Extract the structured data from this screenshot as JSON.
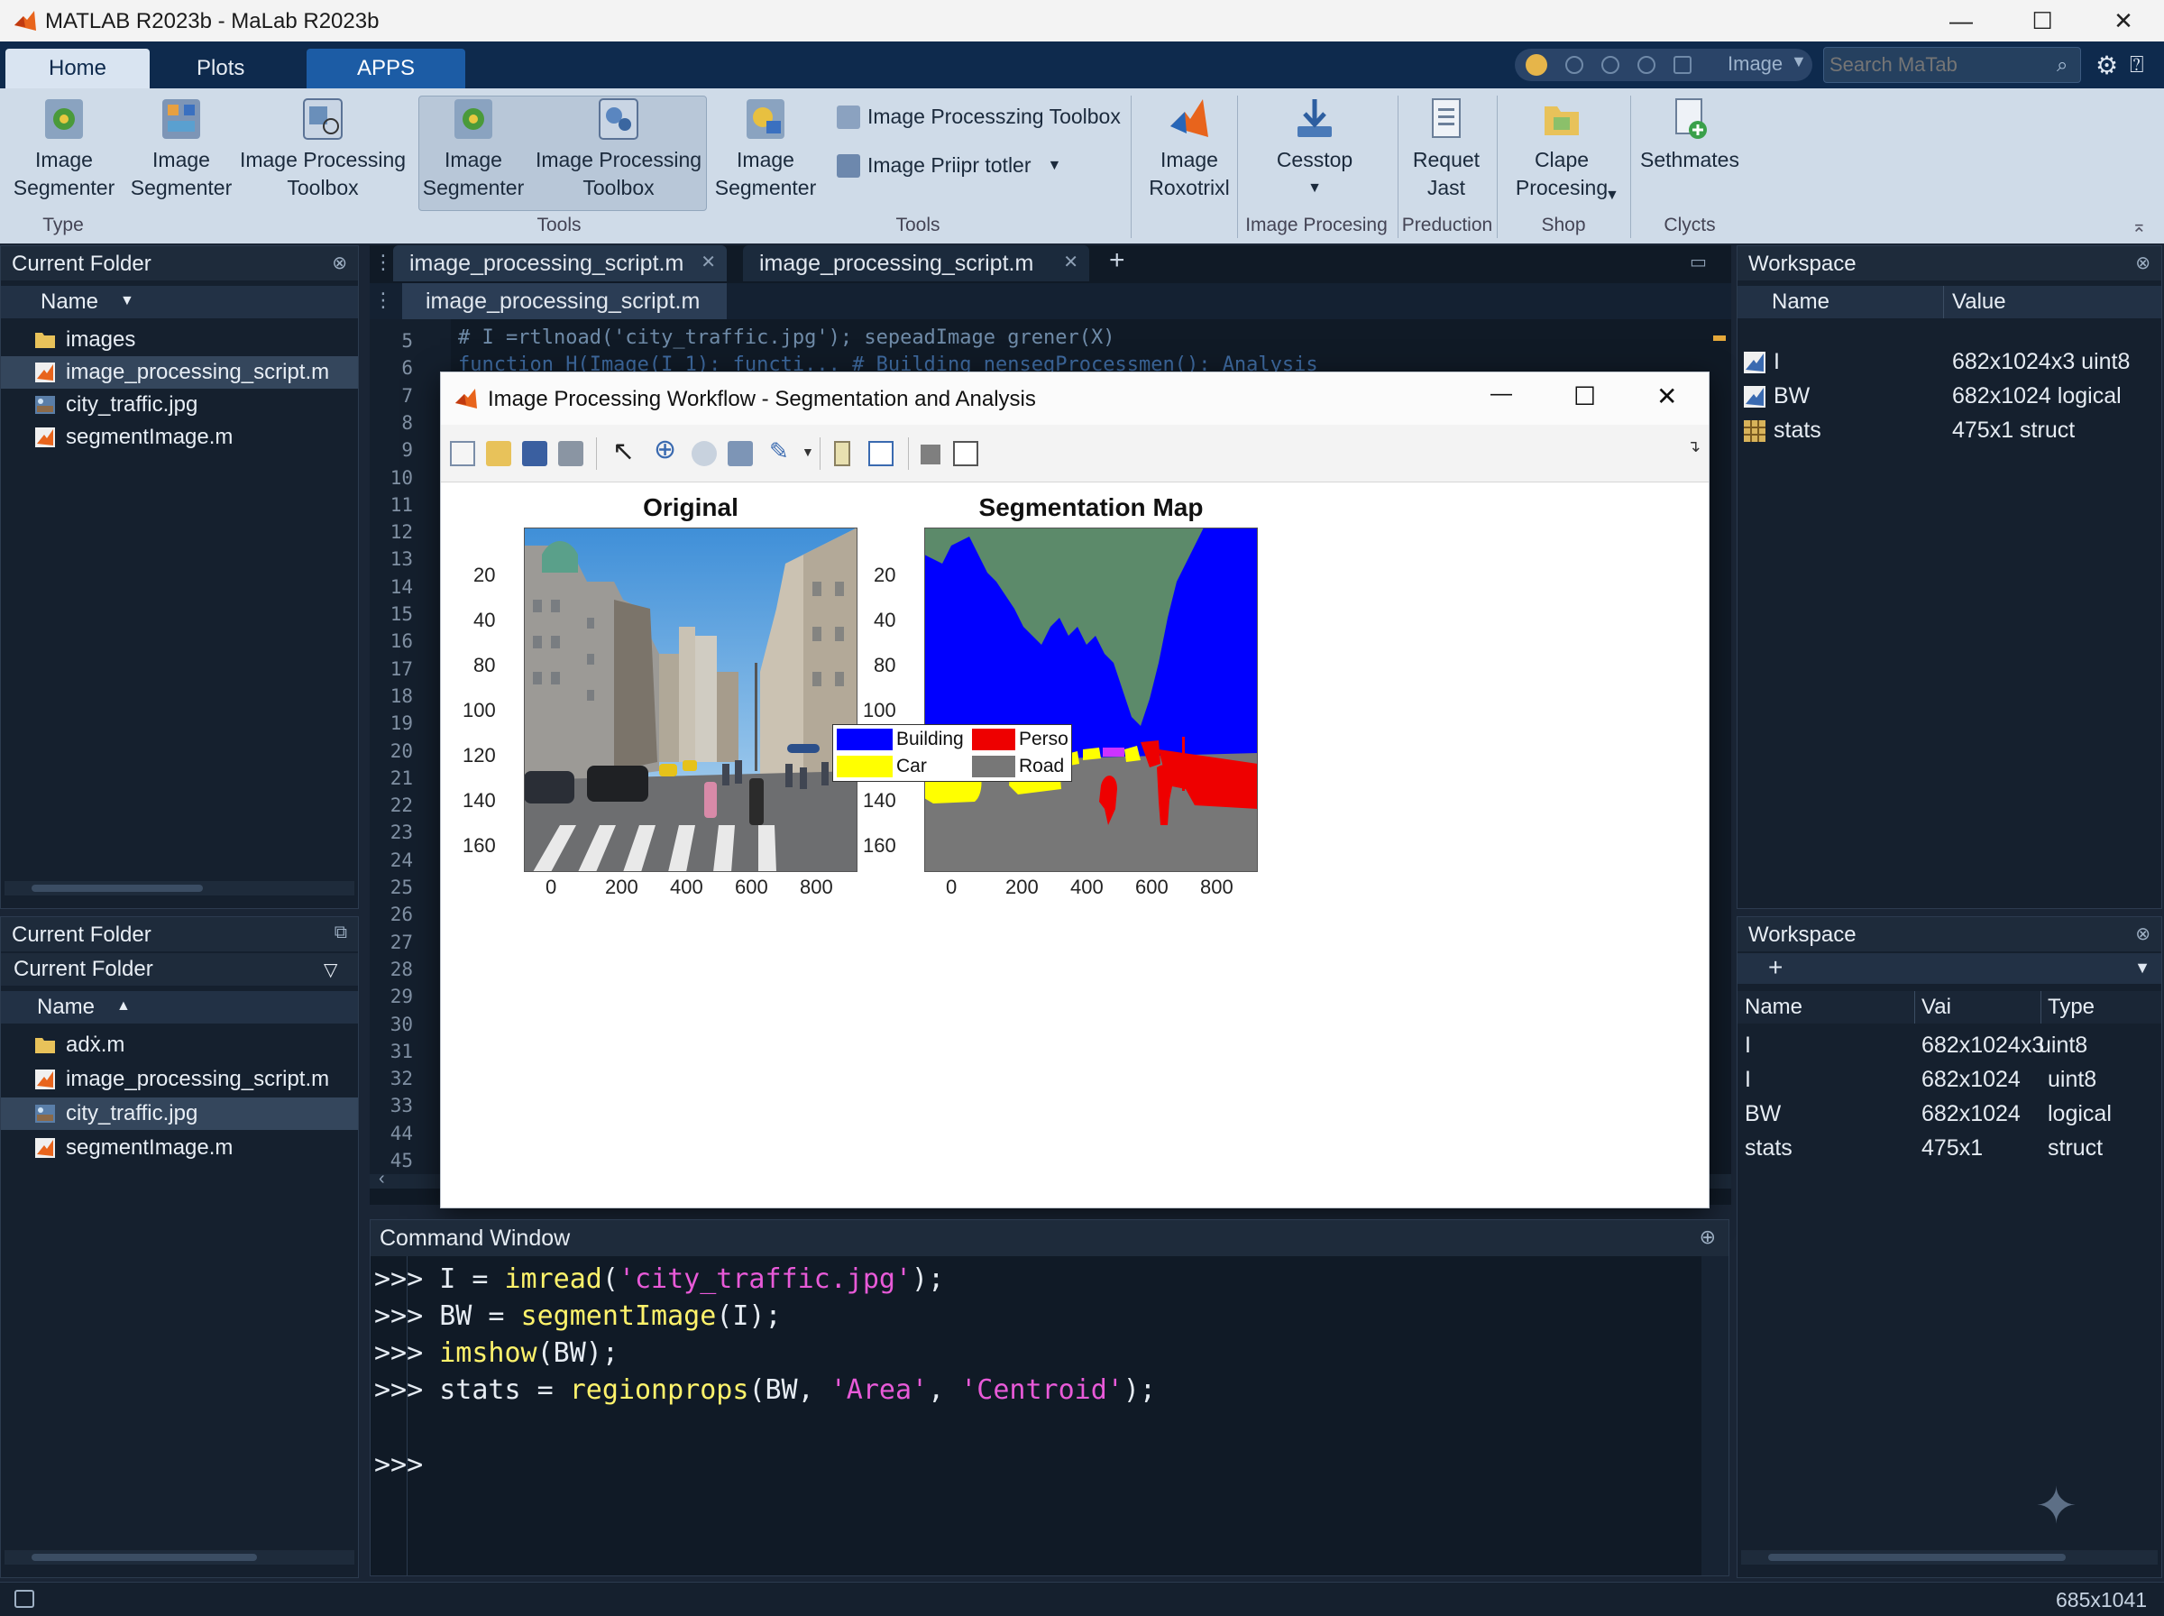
{
  "window": {
    "title": "MATLAB R2023b - MaLab R2023b"
  },
  "ribbon_tabs": [
    "Home",
    "Plots",
    "APPS"
  ],
  "search": {
    "placeholder": "Search MaTab",
    "quick_access_label": "Image"
  },
  "ribbon": {
    "buttons": [
      {
        "label": "Image\nSegmenter",
        "icon": "image-segmenter-icon"
      },
      {
        "label": "Image\nSegmenter",
        "icon": "image-segmenter-icon"
      },
      {
        "label": "Image Processing\nToolbox",
        "icon": "toolbox-icon"
      },
      {
        "label": "Image\nSegmenter",
        "icon": "image-segmenter-icon"
      },
      {
        "label": "Image Processing\nToolbox",
        "icon": "toolbox-icon"
      },
      {
        "label": "Image\nSegmenter",
        "icon": "image-segmenter-icon"
      },
      {
        "label": "Image\nRoxotrixl",
        "icon": "matlab-logo-icon"
      },
      {
        "label": "Cesstop",
        "icon": "download-icon"
      },
      {
        "label": "Requet\nJast",
        "icon": "document-icon"
      },
      {
        "label": "Clape\nProcesing",
        "icon": "folder-icon"
      },
      {
        "label": "Sethmates",
        "icon": "add-file-icon"
      }
    ],
    "small_buttons": [
      "Image Processzing Toolbox",
      "Image Priipr totler"
    ],
    "group_labels": [
      "Type",
      "Tools",
      "Tools",
      "Image Procesing",
      "Preduction",
      "Shop",
      "Clycts"
    ]
  },
  "current_folder_top": {
    "title": "Current Folder",
    "column": "Name",
    "files": [
      {
        "name": "images",
        "type": "folder"
      },
      {
        "name": "image_processing_script.m",
        "type": "mfile",
        "selected": true
      },
      {
        "name": "city_traffic.jpg",
        "type": "image"
      },
      {
        "name": "segmentImage.m",
        "type": "mfile"
      }
    ]
  },
  "current_folder_bottom": {
    "title": "Current Folder",
    "subtitle": "Current Folder",
    "column": "Name",
    "files": [
      {
        "name": "adẋ.m",
        "type": "folder"
      },
      {
        "name": "image_processing_script.m",
        "type": "mfile"
      },
      {
        "name": "city_traffic.jpg",
        "type": "image",
        "selected": true
      },
      {
        "name": "segmentImage.m",
        "type": "mfile"
      }
    ]
  },
  "editor": {
    "tabs": [
      "image_processing_script.m",
      "image_processing_script.m"
    ],
    "subtab": "image_processing_script.m",
    "code_line5": "# I =rtlnoad('city_traffic.jpg'); sepeadImage grener(X)",
    "code_line6": "function H(Image(I 1): functi... # Building nensegProcessmen(): Analysis",
    "line_numbers": [
      "5",
      "6",
      "7",
      "8",
      "9",
      "10",
      "11",
      "12",
      "13",
      "14",
      "15",
      "16",
      "17",
      "18",
      "19",
      "20",
      "21",
      "22",
      "23",
      "24",
      "25",
      "26",
      "27",
      "28",
      "29",
      "30",
      "31",
      "32",
      "33",
      "44",
      "45"
    ]
  },
  "figure": {
    "title": "Image Processing Workflow - Segmentation and Analysis",
    "axes_left_title": "Original",
    "axes_right_title": "Segmentation Map",
    "y_ticks": [
      "20",
      "40",
      "80",
      "100",
      "120",
      "140",
      "160"
    ],
    "x_ticks": [
      "0",
      "200",
      "400",
      "600",
      "800"
    ],
    "legend": [
      {
        "label": "Building",
        "color": "#0000ff"
      },
      {
        "label": "Perso",
        "color": "#ee0000"
      },
      {
        "label": "Car",
        "color": "#ffff00"
      },
      {
        "label": "Road",
        "color": "#777777"
      }
    ]
  },
  "command_window": {
    "title": "Command Window",
    "prompt": ">>>",
    "lines": [
      {
        "pre": "I = ",
        "fn": "imread",
        "args": [
          {
            "t": "(",
            "s": false
          },
          {
            "t": "'city_traffic.jpg'",
            "s": true
          },
          {
            "t": ");",
            "s": false
          }
        ]
      },
      {
        "pre": "BW = ",
        "fn": "segmentImage",
        "args": [
          {
            "t": "(I);",
            "s": false
          }
        ]
      },
      {
        "pre": "",
        "fn": "imshow",
        "args": [
          {
            "t": "(BW);",
            "s": false
          }
        ]
      },
      {
        "pre": "stats = ",
        "fn": "regionprops",
        "args": [
          {
            "t": "(BW, ",
            "s": false
          },
          {
            "t": "'Area'",
            "s": true
          },
          {
            "t": ", ",
            "s": false
          },
          {
            "t": "'Centroid'",
            "s": true
          },
          {
            "t": ");",
            "s": false
          }
        ]
      }
    ]
  },
  "workspace_top": {
    "title": "Workspace",
    "columns": [
      "Name",
      "Value"
    ],
    "rows": [
      {
        "name": "I",
        "value": "682x1024x3 uint8"
      },
      {
        "name": "BW",
        "value": "682x1024 logical"
      },
      {
        "name": "stats",
        "value": "475x1 struct"
      }
    ]
  },
  "workspace_bottom": {
    "title": "Workspace",
    "columns": [
      "Name",
      "Vai",
      "Type"
    ],
    "rows": [
      {
        "name": "I",
        "value": "682x1024x3",
        "type": "uint8"
      },
      {
        "name": "I",
        "value": "682x1024",
        "type": "uint8"
      },
      {
        "name": "BW",
        "value": "682x1024",
        "type": "logical"
      },
      {
        "name": "stats",
        "value": "475x1",
        "type": "struct"
      }
    ]
  },
  "status": {
    "size_text": "685x1041"
  },
  "colors": {
    "ribbon_dark": "#0e2a4d",
    "panel_bg": "#15202e",
    "accent": "#1c5ca5"
  }
}
